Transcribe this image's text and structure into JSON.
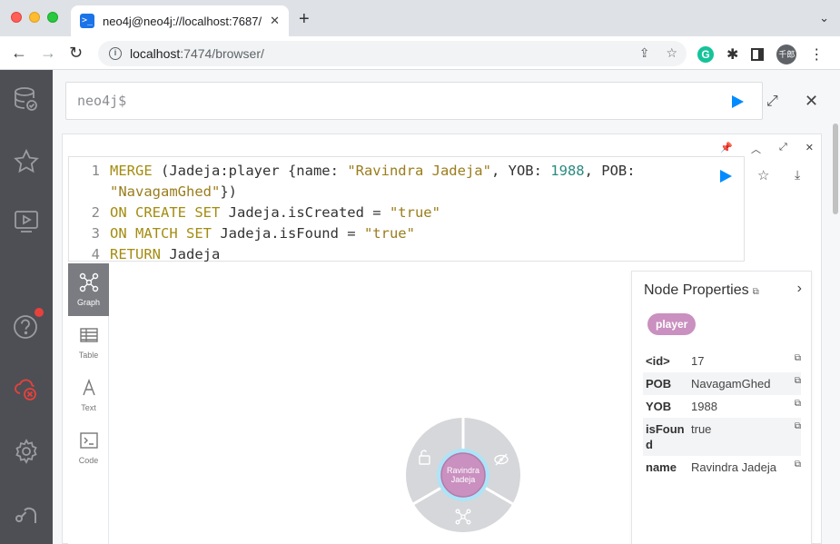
{
  "browser": {
    "tab_title": "neo4j@neo4j://localhost:7687/",
    "tab_favicon": ">_",
    "url_host": "localhost",
    "url_path": ":7474/browser/",
    "avatar_text": "千郎",
    "grammarly_letter": "G"
  },
  "editor": {
    "prompt": "neo4j$"
  },
  "query": {
    "lines": [
      {
        "n": "1"
      },
      {
        "n": ""
      },
      {
        "n": "2"
      },
      {
        "n": "3"
      },
      {
        "n": "4"
      }
    ],
    "line1_kw": "MERGE",
    "line1_rest": " (Jadeja:player {name: ",
    "line1_str": "\"Ravindra Jadeja\"",
    "line1_yob": ", YOB: ",
    "line1_num": "1988",
    "line1_pob": ", POB:",
    "line1b_str": "\"NavagamGhed\"",
    "line1b_rest": "})",
    "line2_kw": "ON CREATE SET",
    "line2_rest": " Jadeja.isCreated = ",
    "line2_str": "\"true\"",
    "line3_kw": "ON MATCH SET",
    "line3_rest": " Jadeja.isFound = ",
    "line3_str": "\"true\"",
    "line4_kw": "RETURN",
    "line4_rest": " Jadeja"
  },
  "views": {
    "graph": "Graph",
    "table": "Table",
    "text": "Text",
    "code": "Code"
  },
  "graph": {
    "node_caption_line1": "Ravindra",
    "node_caption_line2": "Jadeja",
    "node_color": "#c990c0"
  },
  "properties": {
    "title": "Node Properties",
    "label": "player",
    "rows": [
      {
        "key": "<id>",
        "value": "17"
      },
      {
        "key": "POB",
        "value": "NavagamGhed"
      },
      {
        "key": "YOB",
        "value": "1988"
      },
      {
        "key": "isFound",
        "value": "true"
      },
      {
        "key": "name",
        "value": "Ravindra Jadeja"
      }
    ]
  },
  "colors": {
    "sidebar": "#4d4f55",
    "run_blue": "#018bff",
    "badge_red": "#e8413b"
  }
}
